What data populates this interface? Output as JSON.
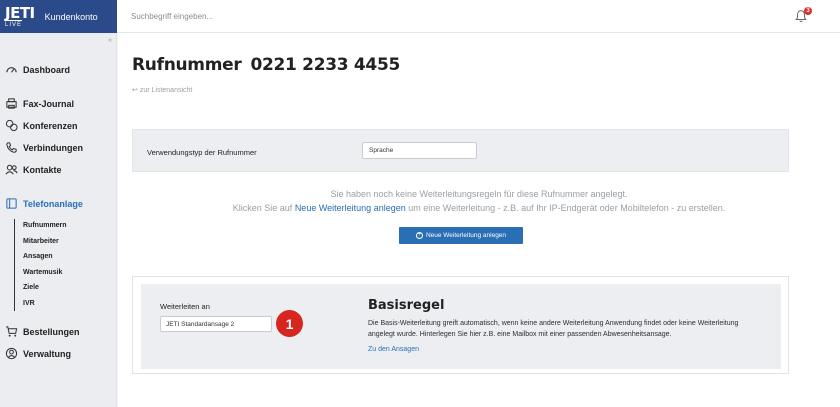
{
  "brand": {
    "logo_top": "JETI",
    "logo_bottom": "LIVE",
    "account": "Kundenkonto"
  },
  "header": {
    "search_placeholder": "Suchbegriff eingeben...",
    "notification_count": "3"
  },
  "sidebar": {
    "items": [
      {
        "label": "Dashboard",
        "icon": "dashboard-icon"
      },
      {
        "label": "Fax-Journal",
        "icon": "fax-icon"
      },
      {
        "label": "Konferenzen",
        "icon": "conference-icon"
      },
      {
        "label": "Verbindungen",
        "icon": "phone-icon"
      },
      {
        "label": "Kontakte",
        "icon": "contacts-icon"
      },
      {
        "label": "Telefonanlage",
        "icon": "phone-system-icon"
      },
      {
        "label": "Bestellungen",
        "icon": "cart-icon"
      },
      {
        "label": "Verwaltung",
        "icon": "user-icon"
      }
    ],
    "subitems": [
      "Rufnummern",
      "Mitarbeiter",
      "Ansagen",
      "Wartemusik",
      "Ziele",
      "IVR"
    ]
  },
  "page": {
    "title_label": "Rufnummer",
    "title_number": "0221 2233 4455",
    "back_link": "zur Listenansicht",
    "usage_label": "Verwendungstyp der Rufnummer",
    "usage_value": "Sprache",
    "empty_line1": "Sie haben noch keine Weiterleitungsregeln für diese Rufnummer angelegt.",
    "empty_line2_prefix": "Klicken Sie auf",
    "empty_line2_link": "Neue Weiterleitung anlegen",
    "empty_line2_suffix": "um eine Weiterleitung - z.B. auf Ihr IP-Endgerät oder Mobiltelefon - zu erstellen.",
    "new_button": "Neue Weiterleitung anlegen",
    "forward_label": "Weiterleiten an",
    "forward_value": "JETI Standardansage 2",
    "marker": "1",
    "basis_title": "Basisregel",
    "basis_text": "Die Basis-Weiterleitung greift automatisch, wenn keine andere Weiterleitung Anwendung findet oder keine Weiterleitung angelegt wurde. Hinterlegen Sie hier z.B. eine Mailbox mit einer passenden Abwesenheitsansage.",
    "basis_link": "Zu den Ansagen"
  },
  "colors": {
    "brand": "#2a4a8a",
    "accent": "#2a6fb5",
    "marker": "#d7251f"
  }
}
